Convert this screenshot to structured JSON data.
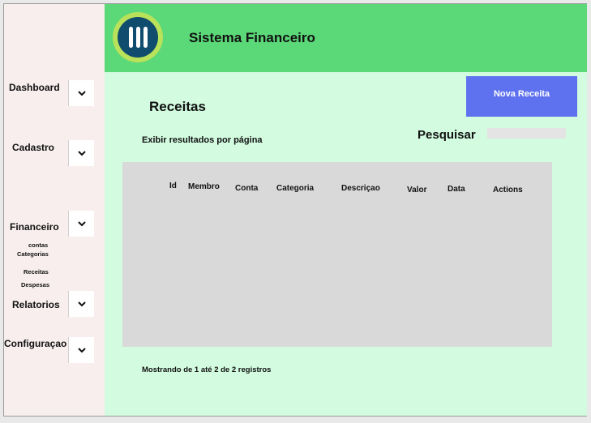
{
  "header": {
    "title": "Sistema Financeiro"
  },
  "sidebar": {
    "dashboard": "Dashboard",
    "cadastro": "Cadastro",
    "financeiro": "Financeiro",
    "financeiro_sub": [
      "contas",
      "Categorias",
      "Receitas",
      "Despesas"
    ],
    "relatorios": "Relatorios",
    "configuracao": "Configuraçao"
  },
  "main": {
    "page_title": "Receitas",
    "new_button": "Nova Receita",
    "per_page_label": "Exibir resultados por página",
    "search_label": "Pesquisar",
    "search_value": "",
    "table": {
      "columns": [
        "Id",
        "Membro",
        "Conta",
        "Categoria",
        "Descriçao",
        "Valor",
        "Data",
        "Actions"
      ],
      "rows": []
    },
    "footer_info": "Mostrando de 1 até 2 de 2 registros"
  },
  "colors": {
    "header_bg": "#5bd878",
    "main_bg": "#d2fbdf",
    "sidebar_bg": "#f8eeee",
    "button_bg": "#5e72f0",
    "table_bg": "#d9d9d9",
    "logo_ring": "#b9e15a",
    "logo_core": "#0f4c6d"
  },
  "icons": {
    "logo": "menu-bars-logo",
    "chevron": "chevron-down-icon"
  }
}
